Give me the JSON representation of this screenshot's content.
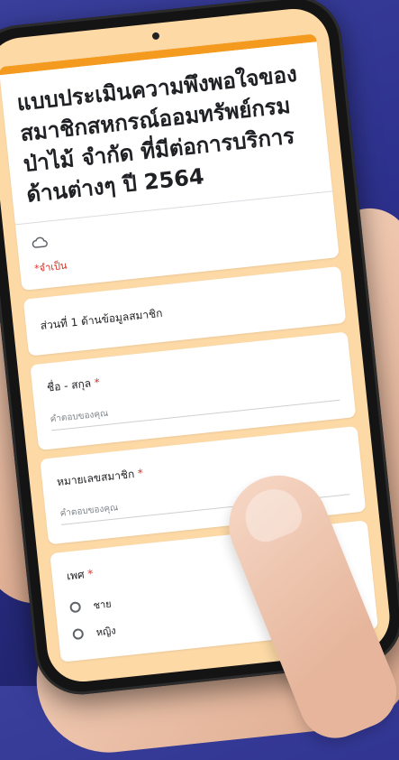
{
  "form": {
    "title": "แบบประเมินความพึงพอใจของสมาชิกสหกรณ์ออมทรัพย์กรมป่าไม้ จำกัด ที่มีต่อการบริการด้านต่างๆ ปี 2564",
    "required_note": "*จำเป็น",
    "section_title": "ส่วนที่ 1 ด้านข้อมูลสมาชิก",
    "questions": [
      {
        "label": "ชื่อ - สกุล",
        "required_mark": "*",
        "placeholder": "คำตอบของคุณ"
      },
      {
        "label": "หมายเลขสมาชิก",
        "required_mark": "*",
        "placeholder": "คำตอบของคุณ"
      }
    ],
    "gender": {
      "label": "เพศ",
      "required_mark": "*",
      "options": [
        "ชาย",
        "หญิง"
      ]
    }
  },
  "colors": {
    "accent": "#f39a1f",
    "background": "#fdd9a6",
    "required": "#d93025",
    "page": "#2b2f8a"
  },
  "icons": {
    "cloud": "cloud-icon",
    "radio": "radio-unchecked-icon"
  }
}
